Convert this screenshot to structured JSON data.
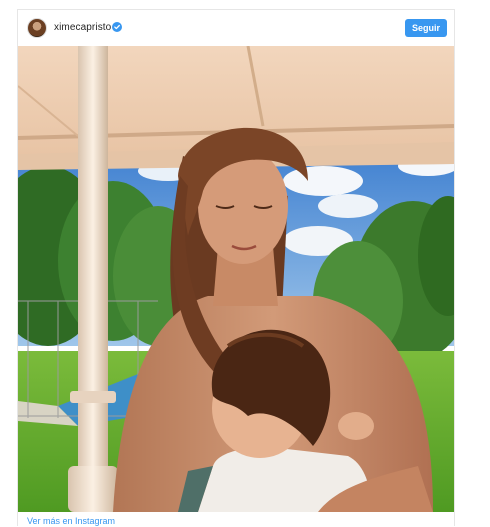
{
  "post": {
    "username": "ximecapristo",
    "follow_label": "Seguir",
    "more_link_label": "Ver más en Instagram"
  },
  "icons": {
    "verified": "verified-badge-icon",
    "avatar": "profile-avatar"
  },
  "colors": {
    "accent": "#3897f0",
    "text": "#262626",
    "border": "#e6e6e6"
  }
}
